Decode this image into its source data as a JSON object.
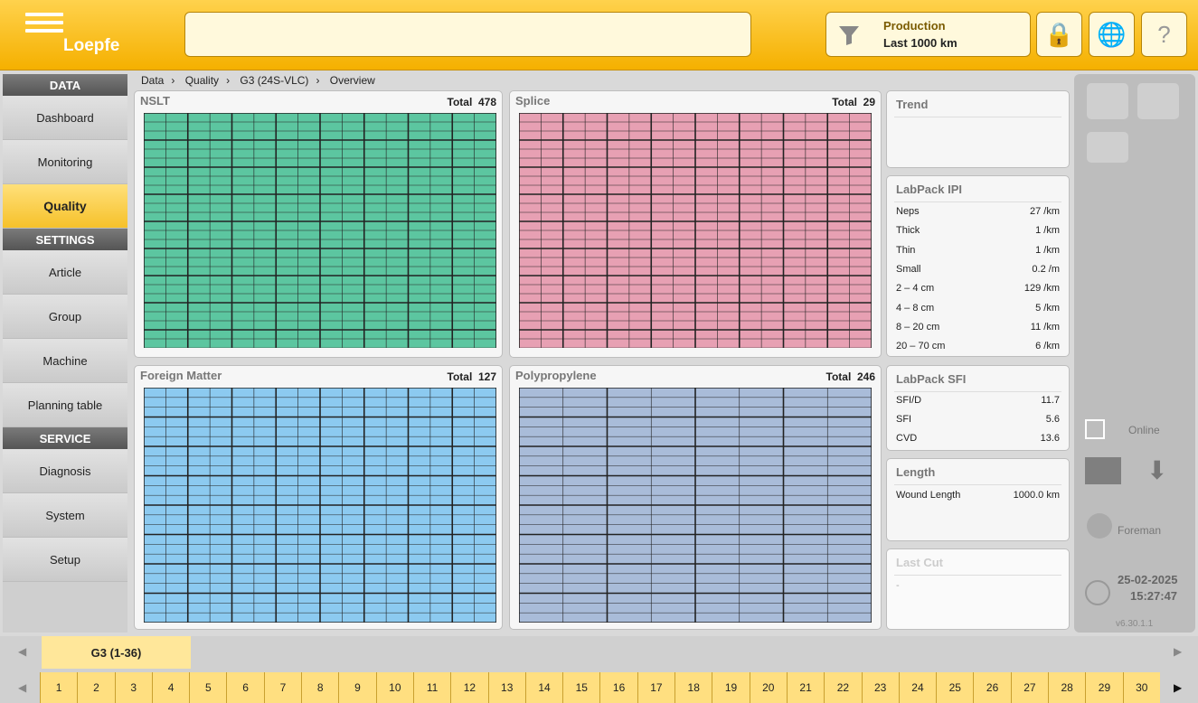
{
  "header": {
    "brand": "Loepfe",
    "filter_line1": "Production",
    "filter_line2": "Last 1000 km",
    "icons": [
      "lock-icon",
      "globe-icon",
      "help-icon"
    ]
  },
  "sidebar": {
    "sections": [
      {
        "title": "DATA",
        "items": [
          "Dashboard",
          "Monitoring",
          "Quality"
        ]
      },
      {
        "title": "SETTINGS",
        "items": [
          "Article",
          "Group",
          "Machine",
          "Planning table"
        ]
      },
      {
        "title": "SERVICE",
        "items": [
          "Diagnosis",
          "System",
          "Setup"
        ]
      }
    ],
    "active": "Quality"
  },
  "breadcrumb": [
    "Data",
    "Quality",
    "G3 (24S-VLC)",
    "Overview"
  ],
  "panels": {
    "nslt": {
      "title": "NSLT",
      "total_label": "Total",
      "total": "478",
      "color": "#5cc6a0"
    },
    "splice": {
      "title": "Splice",
      "total_label": "Total",
      "total": "29",
      "color": "#e7a0b3"
    },
    "fm": {
      "title": "Foreign Matter",
      "total_label": "Total",
      "total": "127",
      "color": "#8ccaf0"
    },
    "pp": {
      "title": "Polypropylene",
      "total_label": "Total",
      "total": "246",
      "color": "#a9bcd9"
    }
  },
  "trend": {
    "title": "Trend"
  },
  "labpack_ipi": {
    "title": "LabPack IPI",
    "rows": [
      {
        "k": "Neps",
        "v": "27 /km"
      },
      {
        "k": "Thick",
        "v": "1 /km"
      },
      {
        "k": "Thin",
        "v": "1 /km"
      },
      {
        "k": "Small",
        "v": "0.2 /m"
      },
      {
        "k": "2 – 4 cm",
        "v": "129 /km"
      },
      {
        "k": "4 – 8 cm",
        "v": "5 /km"
      },
      {
        "k": "8 – 20 cm",
        "v": "11 /km"
      },
      {
        "k": "20 – 70 cm",
        "v": "6 /km"
      }
    ]
  },
  "labpack_sfi": {
    "title": "LabPack SFI",
    "rows": [
      {
        "k": "SFI/D",
        "v": "11.7"
      },
      {
        "k": "SFI",
        "v": "5.6"
      },
      {
        "k": "CVD",
        "v": "13.6"
      }
    ]
  },
  "length": {
    "title": "Length",
    "rows": [
      {
        "k": "Wound Length",
        "v": "1000.0 km"
      }
    ]
  },
  "last_cut": {
    "title": "Last Cut",
    "value": "-"
  },
  "right": {
    "status": "Online",
    "user": "Foreman",
    "date": "25-02-2025",
    "time": "15:27:47",
    "version": "v6.30.1.1"
  },
  "footer": {
    "group_tab": "G3 (1-36)",
    "spindles": [
      "1",
      "2",
      "3",
      "4",
      "5",
      "6",
      "7",
      "8",
      "9",
      "10",
      "11",
      "12",
      "13",
      "14",
      "15",
      "16",
      "17",
      "18",
      "19",
      "20",
      "21",
      "22",
      "23",
      "24",
      "25",
      "26",
      "27",
      "28",
      "29",
      "30"
    ]
  }
}
